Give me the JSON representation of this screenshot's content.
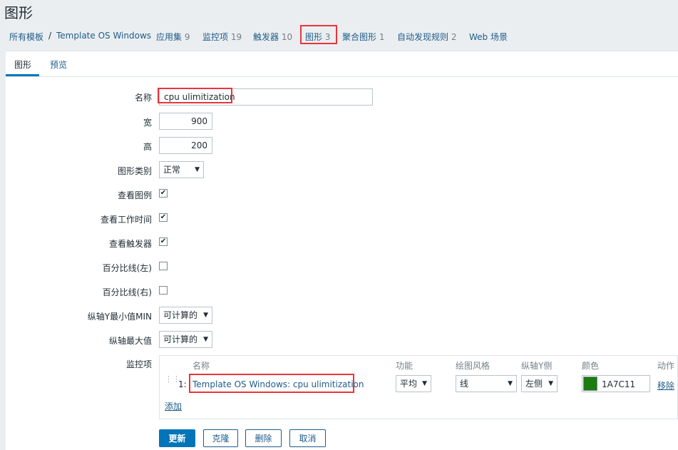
{
  "page_title": "图形",
  "breadcrumb": {
    "all_templates": "所有模板",
    "separator": "/",
    "template": "Template OS Windows",
    "items": [
      {
        "label": "应用集",
        "count": "9"
      },
      {
        "label": "监控项",
        "count": "19"
      },
      {
        "label": "触发器",
        "count": "10"
      },
      {
        "label": "图形",
        "count": "3"
      },
      {
        "label": "聚合图形",
        "count": "1"
      },
      {
        "label": "自动发现规则",
        "count": "2"
      },
      {
        "label": "Web 场景",
        "count": ""
      }
    ]
  },
  "tabs": {
    "graph": "图形",
    "preview": "预览"
  },
  "form": {
    "name_label": "名称",
    "name_value": "cpu ulimitization",
    "width_label": "宽",
    "width_value": "900",
    "height_label": "高",
    "height_value": "200",
    "graph_type_label": "图形类别",
    "graph_type_value": "正常",
    "show_legend_label": "查看图例",
    "show_legend_checked": true,
    "show_working_time_label": "查看工作时间",
    "show_working_time_checked": true,
    "show_triggers_label": "查看触发器",
    "show_triggers_checked": true,
    "percentile_left_label": "百分比线(左)",
    "percentile_left_checked": false,
    "percentile_right_label": "百分比线(右)",
    "percentile_right_checked": false,
    "ymin_label": "纵轴Y最小值MIN",
    "ymin_value": "可计算的",
    "ymax_label": "纵轴最大值",
    "ymax_value": "可计算的",
    "items_label": "监控项"
  },
  "items_table": {
    "headers": {
      "name": "名称",
      "function": "功能",
      "draw_style": "绘图风格",
      "y_axis_side": "纵轴Y侧",
      "color": "颜色",
      "action": "动作"
    },
    "rows": [
      {
        "num": "1:",
        "name": "Template OS Windows: cpu ulimitization",
        "function": "平均",
        "draw_style": "线",
        "y_axis_side": "左侧",
        "color": "1A7C11",
        "action": "移除"
      }
    ],
    "add_label": "添加"
  },
  "buttons": {
    "update": "更新",
    "clone": "克隆",
    "delete": "删除",
    "cancel": "取消"
  },
  "colors": {
    "accent": "#0275b8",
    "link": "#1f5c8a",
    "highlight": "#e8353b",
    "item_color": "#1A7C11"
  },
  "checkmark_glyph": "✔",
  "arrow_glyph": "▼",
  "drag_glyph": "⋮⋮"
}
